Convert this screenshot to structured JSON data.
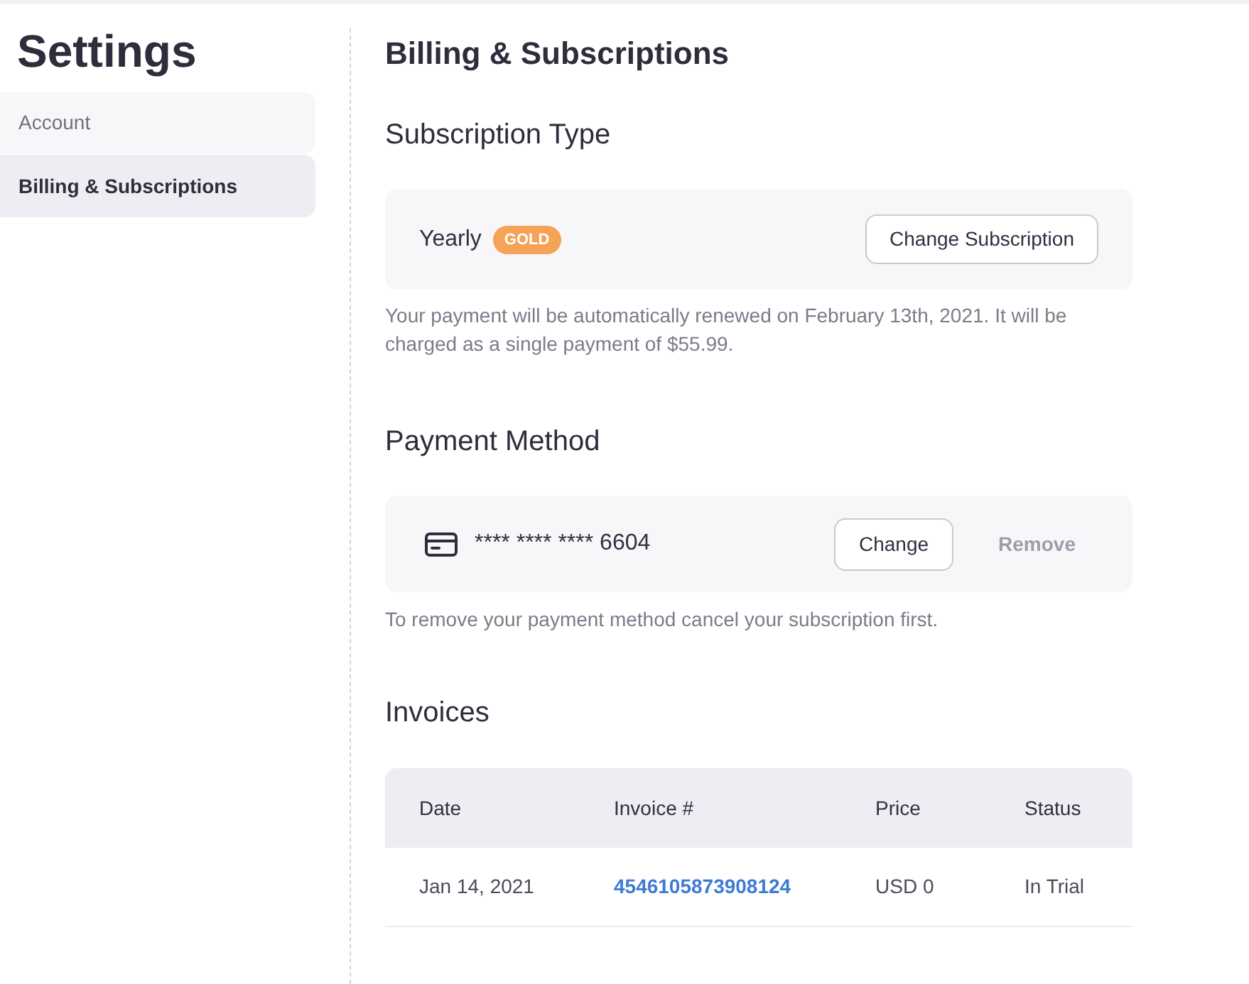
{
  "sidebar": {
    "title": "Settings",
    "items": [
      {
        "label": "Account",
        "selected": false
      },
      {
        "label": "Billing & Subscriptions",
        "selected": true
      }
    ]
  },
  "main": {
    "title": "Billing & Subscriptions",
    "subscription": {
      "heading": "Subscription Type",
      "plan": "Yearly",
      "badge": "GOLD",
      "button": "Change Subscription",
      "note": "Your payment will be automatically renewed on February 13th, 2021. It will be charged as a single payment of $55.99."
    },
    "payment": {
      "heading": "Payment Method",
      "card_number": "**** **** **** 6604",
      "buttons": [
        {
          "label": "Change",
          "disabled": false
        },
        {
          "label": "Remove",
          "disabled": true
        }
      ],
      "note": "To remove your payment method cancel your subscription first."
    },
    "invoices": {
      "heading": "Invoices",
      "columns": [
        "Date",
        "Invoice #",
        "Price",
        "Status"
      ],
      "rows": [
        {
          "cells": [
            {
              "text": "Jan 14, 2021",
              "kind": "text"
            },
            {
              "text": "4546105873908124",
              "kind": "link"
            },
            {
              "text": "USD 0",
              "kind": "text"
            },
            {
              "text": "In Trial",
              "kind": "text"
            }
          ]
        }
      ]
    }
  }
}
